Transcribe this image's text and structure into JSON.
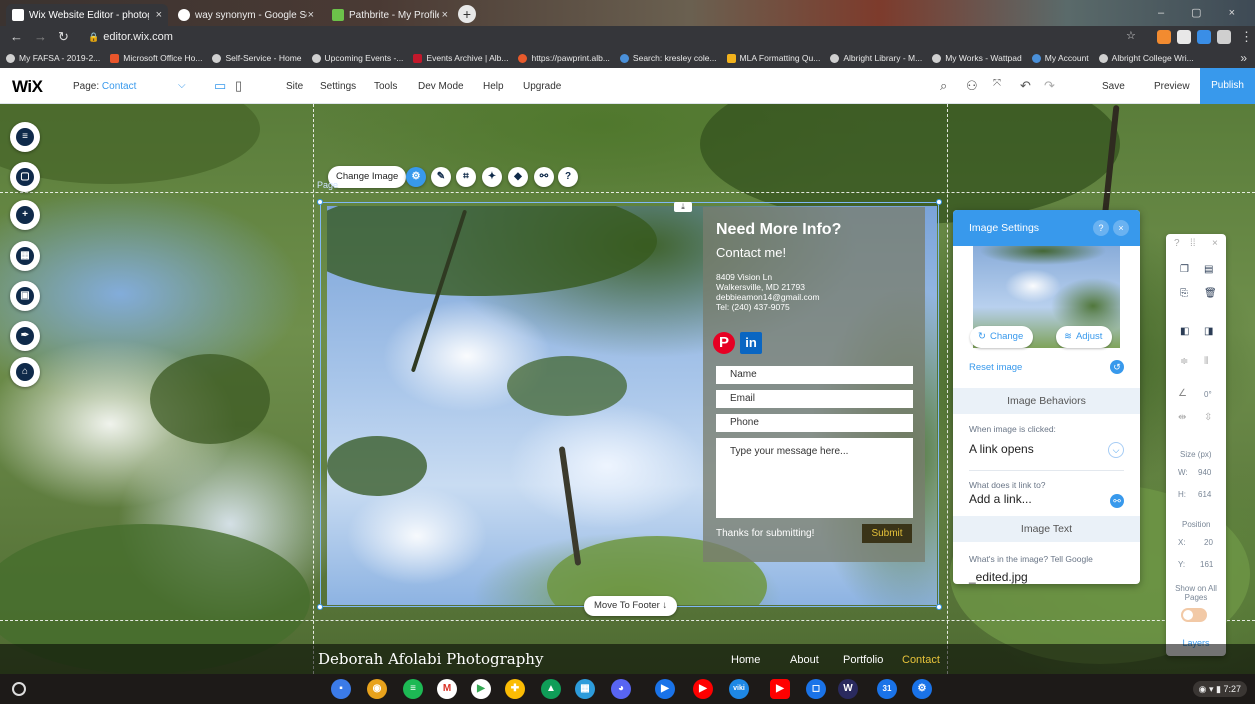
{
  "browser": {
    "tabs": [
      {
        "title": "Wix Website Editor - photography",
        "close": "×"
      },
      {
        "title": "way synonym - Google Search",
        "close": "×"
      },
      {
        "title": "Pathbrite - My Profile",
        "close": "×"
      }
    ],
    "new_tab": "+",
    "window_controls": "– ▢ ×",
    "url": "editor.wix.com",
    "bookmarks": [
      "My FAFSA - 2019-2...",
      "Microsoft Office Ho...",
      "Self-Service - Home",
      "Upcoming Events -...",
      "Events Archive | Alb...",
      "https://pawprint.alb...",
      "Search: kresley cole...",
      "MLA Formatting Qu...",
      "Albright Library - M...",
      "My Works - Wattpad",
      "My Account",
      "Albright College Wri..."
    ],
    "bookmarks_more": "»"
  },
  "wix": {
    "logo": "WiX",
    "page_prefix": "Page:",
    "page_name": "Contact",
    "menu": [
      "Site",
      "Settings",
      "Tools",
      "Dev Mode",
      "Help",
      "Upgrade"
    ],
    "save": "Save",
    "preview": "Preview",
    "publish": "Publish"
  },
  "image_toolbar": {
    "change_image": "Change Image",
    "page_tag": "Page"
  },
  "contact": {
    "heading": "Need More Info?",
    "subheading": "Contact me!",
    "address_lines": [
      "8409 Vision Ln",
      "Walkersville, MD 21793",
      "debbieamon14@gmail.com",
      "Tel: (240) 437-9075"
    ],
    "fields": {
      "name": "Name",
      "email": "Email",
      "phone": "Phone"
    },
    "message_placeholder": "Type your message here...",
    "thanks": "Thanks for submitting!",
    "submit": "Submit"
  },
  "move_to_footer": "Move To Footer ↓",
  "settings": {
    "title": "Image Settings",
    "change": "Change",
    "adjust": "Adjust",
    "reset": "Reset image",
    "behaviors": "Image Behaviors",
    "when_clicked_label": "When image is clicked:",
    "when_clicked_value": "A link opens",
    "link_label": "What does it link to?",
    "link_value": "Add a link...",
    "image_text": "Image Text",
    "alt_label": "What's in the image? Tell Google",
    "alt_value": "_edited.jpg"
  },
  "right_panel": {
    "rotation": "0°",
    "size_label": "Size (px)",
    "w_label": "W:",
    "w": "940",
    "h_label": "H:",
    "h": "614",
    "position_label": "Position",
    "x_label": "X:",
    "x": "20",
    "y_label": "Y:",
    "y": "161",
    "show_all_pages": "Show on All Pages",
    "layers": "Layers"
  },
  "footer": {
    "brand": "Deborah Afolabi Photography",
    "nav": [
      "Home",
      "About",
      "Portfolio",
      "Contact"
    ]
  },
  "shelf": {
    "time": "7:27"
  }
}
